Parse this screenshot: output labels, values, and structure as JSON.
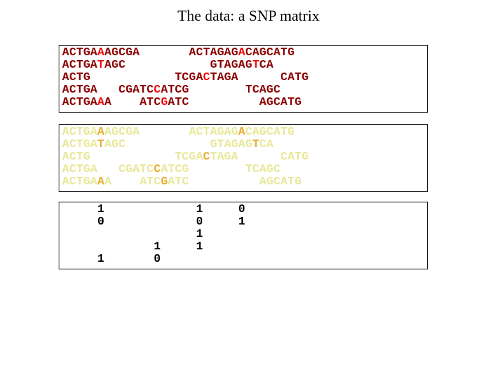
{
  "title": "The data: a SNP matrix",
  "sequences": [
    {
      "gap0": "",
      "left": "ACTGA",
      "snp1": "A",
      "mid1": "AGCGA",
      "gap1": "       ",
      "mid2": "ACTAGAG",
      "snp2": "A",
      "right": "CAGCATG"
    },
    {
      "gap0": "",
      "left": "ACTGA",
      "snp1": "T",
      "mid1": "AGC",
      "gap1": "            ",
      "mid2": "GTAGAG",
      "snp2": "T",
      "right": "CA"
    },
    {
      "gap0": "",
      "left": "ACTG",
      "snp1": "",
      "mid1": "",
      "gap1": "            ",
      "mid2": "TCGA",
      "snp2": "C",
      "right": "TAGA      CATG"
    },
    {
      "gap0": "",
      "left": "ACTGA",
      "snp1": "",
      "mid1": "   CGATC",
      "gap1": "",
      "mid2": "",
      "snp2": "C",
      "right": "ATCG        TCAGC"
    },
    {
      "gap0": "",
      "left": "ACTGA",
      "snp1": "A",
      "mid1": "A    ATC",
      "gap1": "",
      "mid2": "",
      "snp2": "G",
      "right": "ATC          AGCATG"
    }
  ],
  "binary": [
    {
      "b0": "",
      "g0": "     ",
      "c1": "1",
      "g1": "             ",
      "c2": "1",
      "g2": "     ",
      "c3": "0",
      "g3": ""
    },
    {
      "b0": "",
      "g0": "     ",
      "c1": "0",
      "g1": "             ",
      "c2": "0",
      "g2": "     ",
      "c3": "1",
      "g3": ""
    },
    {
      "b0": "",
      "g0": "",
      "c1": "",
      "g1": "                   ",
      "c2": "1",
      "g2": "",
      "c3": "",
      "g3": ""
    },
    {
      "b0": "",
      "g0": "             ",
      "c1": "1",
      "g1": "",
      "c2": "",
      "g2": "     ",
      "c3": "1",
      "g3": ""
    },
    {
      "b0": "",
      "g0": "     ",
      "c1": "1",
      "g1": "       ",
      "c2": "0",
      "g2": "",
      "c3": "",
      "g3": ""
    }
  ]
}
